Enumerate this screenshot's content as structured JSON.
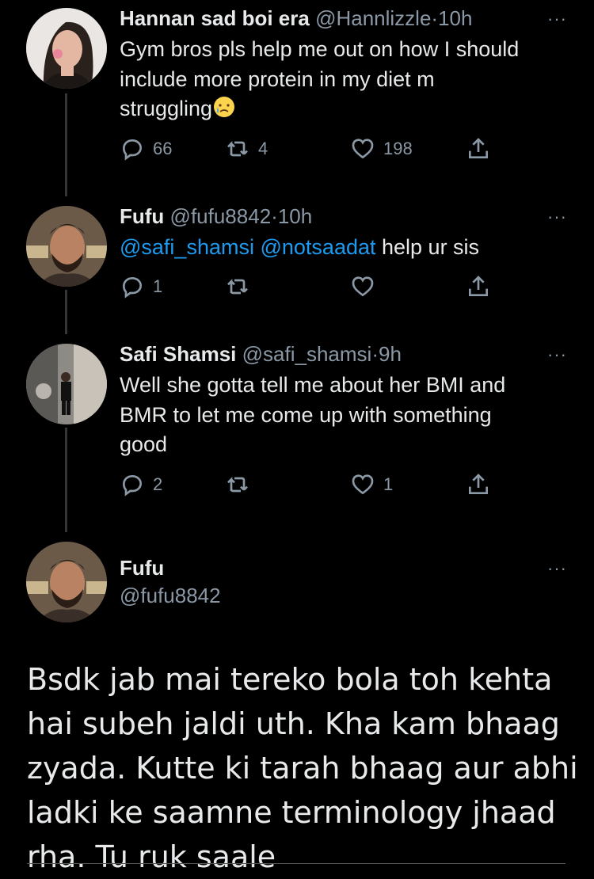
{
  "tweets": [
    {
      "name": "Hannan sad boi era",
      "handle": "@Hannlizzle",
      "time": "10h",
      "text_lines": [
        "Gym bros pls help me out on how I should",
        "include more protein in my diet m",
        "struggling"
      ],
      "emoji": "crying-face-emoji",
      "replies": "66",
      "retweets": "4",
      "likes": "198"
    },
    {
      "name": "Fufu",
      "handle": "@fufu8842",
      "time": "10h",
      "mention1": "@safi_shamsi",
      "mention2": "@notsaadat",
      "text_rest": " help ur sis",
      "replies": "1",
      "retweets": "",
      "likes": ""
    },
    {
      "name": "Safi Shamsi",
      "handle": "@safi_shamsi",
      "time": "9h",
      "text_lines": [
        "Well she gotta tell me about her BMI and",
        "BMR to let me come up with something",
        "good"
      ],
      "replies": "2",
      "retweets": "",
      "likes": "1"
    }
  ],
  "main_tweet": {
    "name": "Fufu",
    "handle": "@fufu8842",
    "text_lines": [
      "Bsdk jab mai tereko bola toh kehta",
      "hai subeh jaldi uth. Kha kam bhaag",
      "zyada. Kutte ki tarah bhaag aur abhi",
      "ladki ke saamne terminology jhaad",
      "rha. Tu ruk saale"
    ]
  },
  "separator": "·",
  "more_icon": "···",
  "colors": {
    "background": "#000000",
    "text": "#e7e9ea",
    "secondary": "#8b98a5",
    "link": "#1d9bf0"
  }
}
